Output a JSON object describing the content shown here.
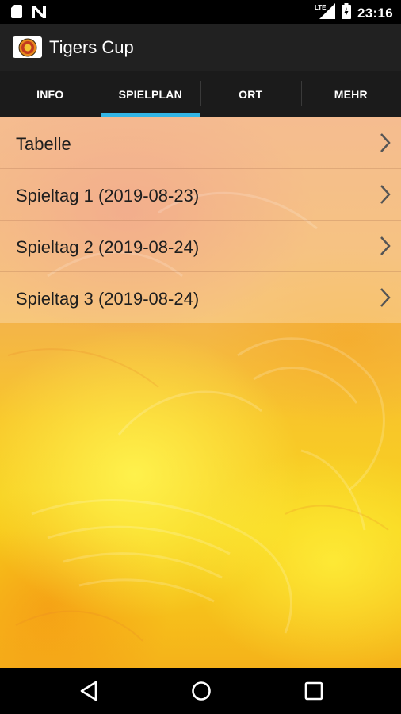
{
  "status_bar": {
    "time": "23:16",
    "network": "LTE",
    "left_icons": [
      "sd-card-icon",
      "n-notification-icon"
    ],
    "right_icons": [
      "signal-icon",
      "battery-icon"
    ]
  },
  "app_bar": {
    "title": "Tigers Cup",
    "logo": "tigers-logo"
  },
  "tabs": [
    {
      "label": "INFO",
      "active": false
    },
    {
      "label": "SPIELPLAN",
      "active": true
    },
    {
      "label": "ORT",
      "active": false
    },
    {
      "label": "MEHR",
      "active": false
    }
  ],
  "list": {
    "items": [
      {
        "label": "Tabelle"
      },
      {
        "label": "Spieltag 1 (2019-08-23)"
      },
      {
        "label": "Spieltag 2 (2019-08-24)"
      },
      {
        "label": "Spieltag 3 (2019-08-24)"
      }
    ]
  },
  "nav_bar": {
    "buttons": [
      "back-icon",
      "home-icon",
      "recents-icon"
    ]
  },
  "colors": {
    "app_bar": "#212121",
    "tab_bar": "#1b1b1b",
    "tab_indicator": "#33b5e5"
  }
}
